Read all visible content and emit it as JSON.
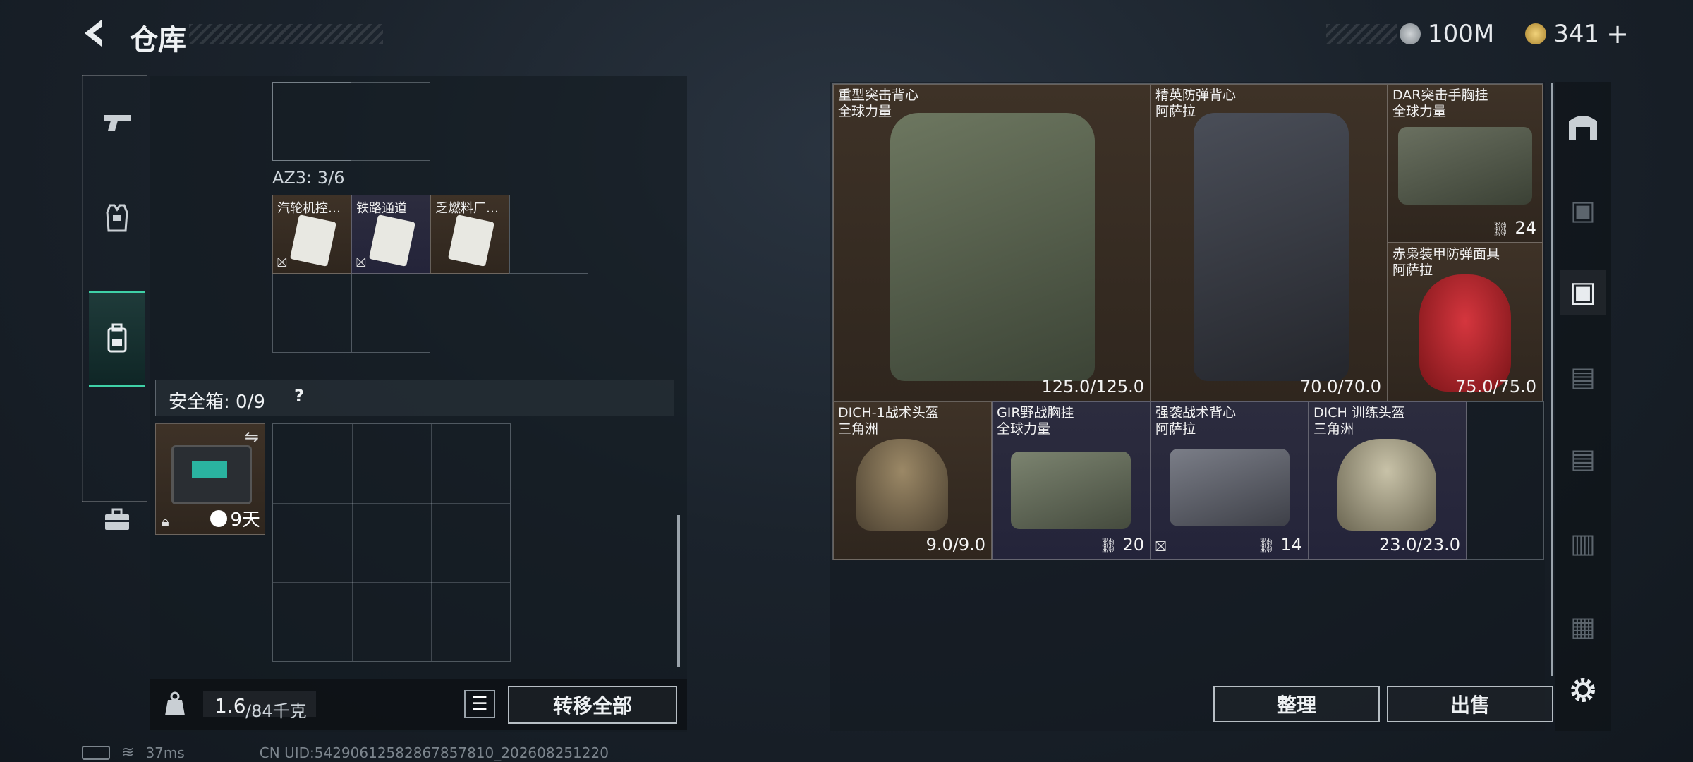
{
  "header": {
    "title": "仓库",
    "currency1": "100M",
    "currency2": "341",
    "add_symbol": "+"
  },
  "left_nav": [
    "weapon-tab",
    "armor-tab",
    "backpack-tab",
    "toolbox-tab"
  ],
  "container": {
    "az3_label": "AZ3: 3/6",
    "items": [
      {
        "name": "汽轮机控…"
      },
      {
        "name": "铁路通道"
      },
      {
        "name": "乏燃料厂…"
      }
    ],
    "safe_box_label": "安全箱: 0/9",
    "safe_box_help": "?",
    "safe_box_item_timer": "9天",
    "weight_current": "1.6",
    "weight_total": "/84千克",
    "transfer_all": "转移全部"
  },
  "storage": {
    "items": [
      {
        "name": "重型突击背心",
        "sub": "全球力量",
        "value": "125.0/125.0",
        "rarity": "brown"
      },
      {
        "name": "精英防弹背心",
        "sub": "阿萨拉",
        "value": "70.0/70.0",
        "rarity": "brown"
      },
      {
        "name": "DAR突击手胸挂",
        "sub": "全球力量",
        "value": "24",
        "rarity": "brown"
      },
      {
        "name": "赤枭装甲防弹面具",
        "sub": "阿萨拉",
        "value": "75.0/75.0",
        "rarity": "brown"
      },
      {
        "name": "DICH-1战术头盔",
        "sub": "三角洲",
        "value": "9.0/9.0",
        "rarity": "brown"
      },
      {
        "name": "GIR野战胸挂",
        "sub": "全球力量",
        "value": "20",
        "rarity": "purple"
      },
      {
        "name": "强袭战术背心",
        "sub": "阿萨拉",
        "value": "14",
        "rarity": "purple"
      },
      {
        "name": "DICH 训练头盔",
        "sub": "三角洲",
        "value": "23.0/23.0",
        "rarity": "purple"
      }
    ],
    "sort_button": "整理",
    "sell_button": "出售"
  },
  "status": {
    "ping": "37ms",
    "uid": "CN UID:542906125828678578​10_202608251220"
  },
  "colors": {
    "accent": "#3fd1a7",
    "brown_rarity": "#3e3227",
    "purple_rarity": "#2c2c3e"
  }
}
